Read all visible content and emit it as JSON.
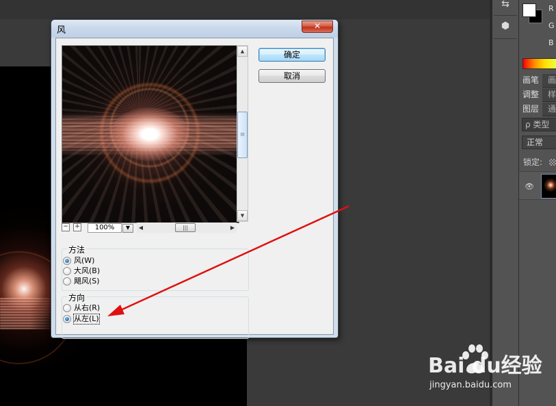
{
  "dialog": {
    "title": "风",
    "close_glyph": "✕",
    "ok_label": "确定",
    "cancel_label": "取消",
    "zoom": "100%",
    "zoom_out_glyph": "−",
    "zoom_in_glyph": "+",
    "method": {
      "label": "方法",
      "options": [
        {
          "label": "风(W)",
          "checked": true
        },
        {
          "label": "大风(B)",
          "checked": false
        },
        {
          "label": "飓风(S)",
          "checked": false
        }
      ]
    },
    "direction": {
      "label": "方向",
      "options": [
        {
          "label": "从右(R)",
          "checked": false
        },
        {
          "label": "从左(L)",
          "checked": true
        }
      ]
    }
  },
  "panels": {
    "color": {
      "r_label": "R",
      "g_label": "G",
      "b_label": "B"
    },
    "tab_row_1": [
      "画笔",
      "画"
    ],
    "tab_row_2": [
      "调整",
      "样"
    ],
    "tab_row_3": [
      "图层",
      "通"
    ],
    "layers": {
      "search_placeholder": "ρ 类型",
      "blend_mode": "正常",
      "lock_label": "锁定:"
    }
  },
  "watermark": {
    "logo": "Bai  du经验",
    "url": "jingyan.baidu.com"
  },
  "colors": {
    "annotation_arrow": "#e01010",
    "ps_background": "#3a3a3a",
    "ps_panel": "#535353",
    "dialog_face": "#f0f0f0"
  }
}
